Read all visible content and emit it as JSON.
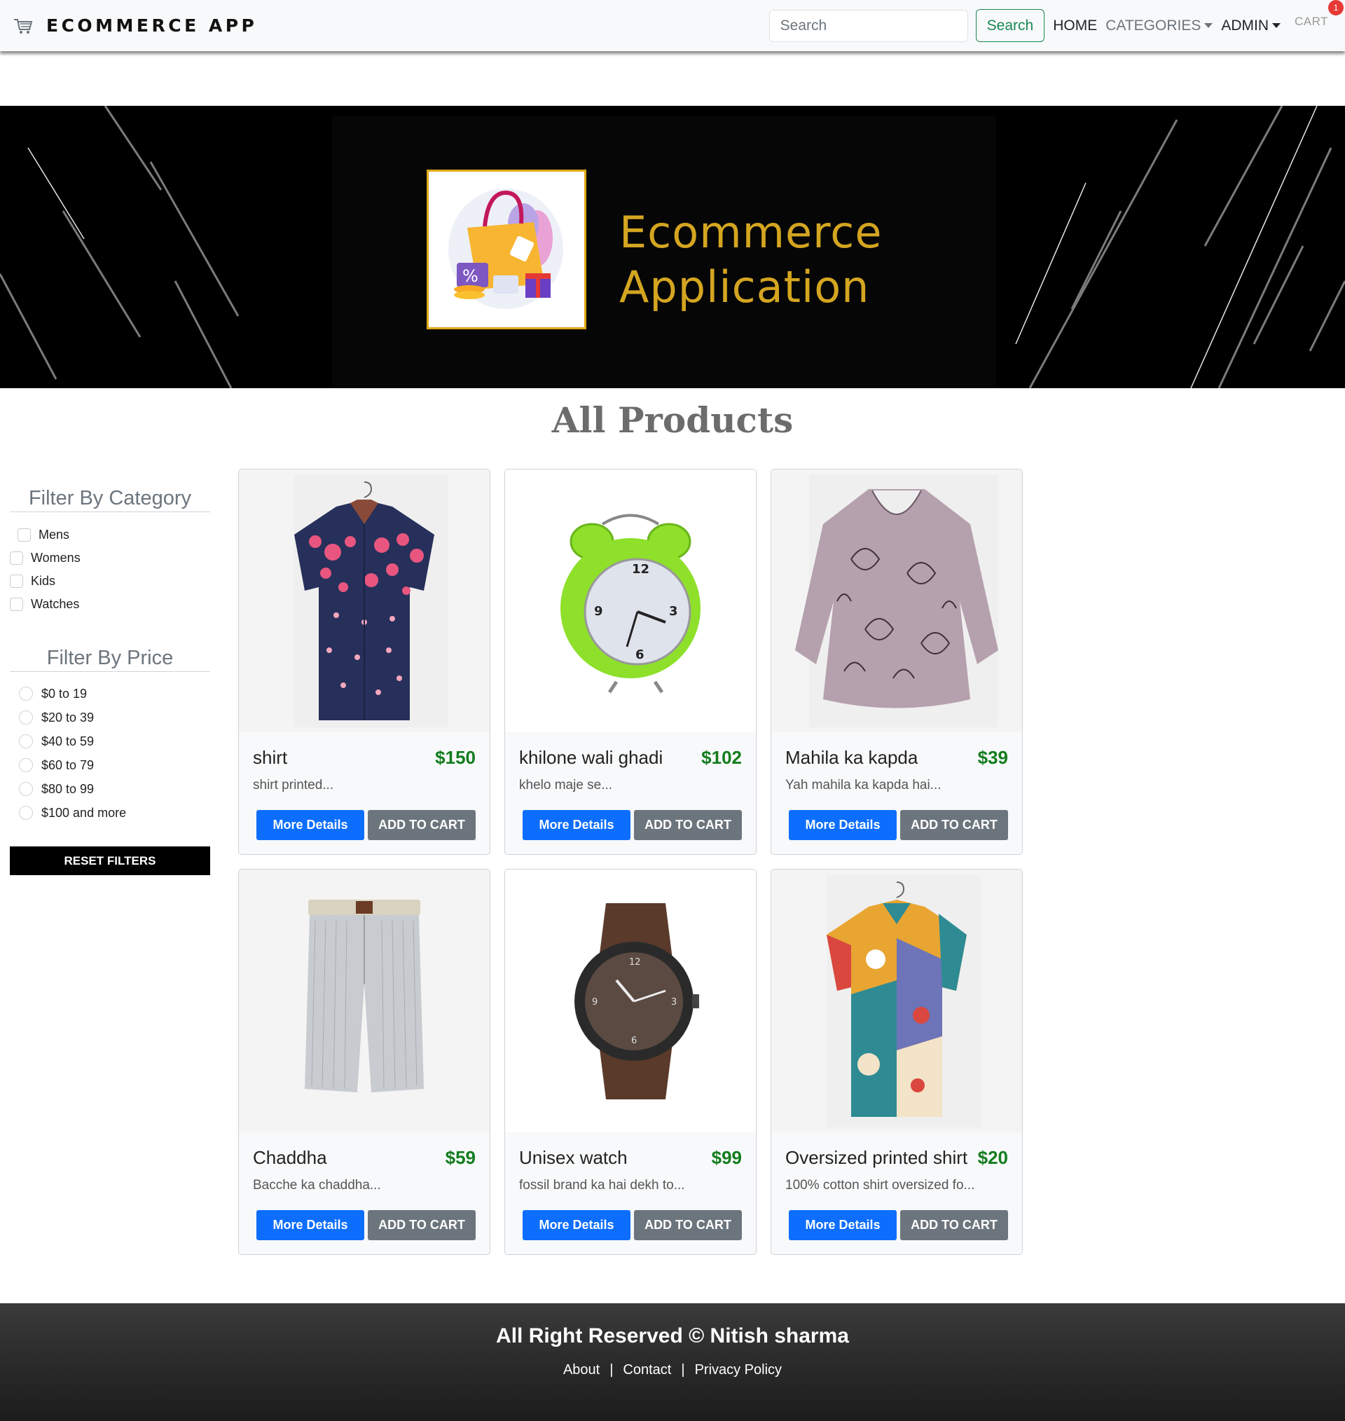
{
  "navbar": {
    "brand": "ECOMMERCE APP",
    "brand_icon": "shopping-cart-icon",
    "search_placeholder": "Search",
    "search_button": "Search",
    "links": {
      "home": "HOME",
      "categories": "CATEGORIES",
      "admin": "ADMIN",
      "cart": "CART"
    },
    "cart_count": "1"
  },
  "banner": {
    "title_line1": "Ecommerce",
    "title_line2": "Application",
    "logo_icon": "shopping-bag-icon"
  },
  "heading": "All Products",
  "filters": {
    "category_title": "Filter By Category",
    "categories": [
      "Mens",
      "Womens",
      "Kids",
      "Watches"
    ],
    "price_title": "Filter By Price",
    "prices": [
      "$0 to 19",
      "$20 to 39",
      "$40 to 59",
      "$60 to 79",
      "$80 to 99",
      "$100 and more"
    ],
    "reset": "RESET FILTERS"
  },
  "products": [
    {
      "name": "shirt",
      "price": "$150",
      "desc": "shirt printed...",
      "image": "floral-shirt-image"
    },
    {
      "name": "khilone wali ghadi",
      "price": "$102",
      "desc": "khelo maje se...",
      "image": "alarm-clock-image"
    },
    {
      "name": "Mahila ka kapda",
      "price": "$39",
      "desc": "Yah mahila ka kapda hai...",
      "image": "womens-top-image"
    },
    {
      "name": "Chaddha",
      "price": "$59",
      "desc": "Bacche ka chaddha...",
      "image": "shorts-image"
    },
    {
      "name": "Unisex watch",
      "price": "$99",
      "desc": "fossil brand ka hai dekh to...",
      "image": "wrist-watch-image"
    },
    {
      "name": "Oversized printed shirt",
      "price": "$20",
      "desc": "100% cotton shirt oversized fo...",
      "image": "printed-shirt-image"
    }
  ],
  "buttons": {
    "more": "More Details",
    "cart": "ADD TO CART"
  },
  "footer": {
    "title": "All Right Reserved © Nitish sharma",
    "links": [
      "About",
      "Contact",
      "Privacy Policy"
    ],
    "separator": "|"
  },
  "colors": {
    "primary": "#0d6efd",
    "secondary": "#6c757d",
    "success": "#198754",
    "price": "#137d1f",
    "banner_gold": "#d4a520",
    "badge": "#e53935"
  }
}
